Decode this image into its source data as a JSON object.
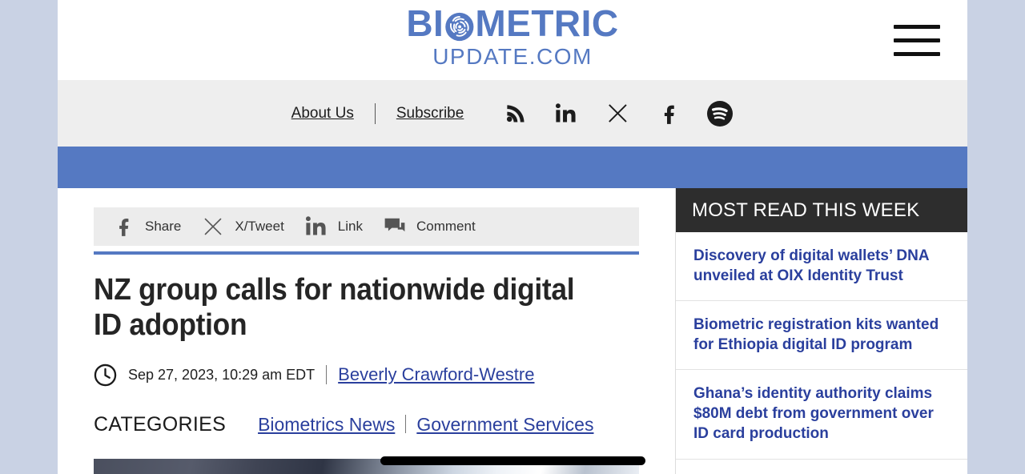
{
  "site": {
    "logo_left": "BI",
    "logo_icon": "fingerprint-icon",
    "logo_right": "METRIC",
    "logo_sub": "UPDATE.COM",
    "menu_icon": "hamburger-icon",
    "brand_color": "#5579c2"
  },
  "utility_nav": {
    "links": [
      {
        "label": "About Us"
      },
      {
        "label": "Subscribe"
      }
    ],
    "social": [
      {
        "name": "rss-icon"
      },
      {
        "name": "linkedin-icon"
      },
      {
        "name": "x-twitter-icon"
      },
      {
        "name": "facebook-icon"
      },
      {
        "name": "spotify-icon"
      }
    ]
  },
  "share_bar": {
    "items": [
      {
        "icon": "facebook-icon",
        "label": "Share"
      },
      {
        "icon": "x-twitter-icon",
        "label": "X/Tweet"
      },
      {
        "icon": "linkedin-icon",
        "label": "Link"
      },
      {
        "icon": "comment-icon",
        "label": "Comment"
      }
    ]
  },
  "article": {
    "headline": "NZ group calls for nationwide digital ID adoption",
    "clock_icon": "clock-icon",
    "date": "Sep 27, 2023, 10:29 am EDT",
    "author": "Beverly Crawford-Westre",
    "categories_label": "CATEGORIES",
    "categories": [
      {
        "label": "Biometrics News"
      },
      {
        "label": "Government Services"
      }
    ]
  },
  "sidebar": {
    "title": "MOST READ THIS WEEK",
    "items": [
      {
        "title": "Discovery of digital wallets’ DNA unveiled at OIX Identity Trust"
      },
      {
        "title": "Biometric registration kits wanted for Ethiopia digital ID program"
      },
      {
        "title": "Ghana’s identity authority claims $80M debt from government over ID card production"
      }
    ]
  },
  "colors": {
    "page_background": "#c9d2e4",
    "brand_blue": "#5579c2",
    "link_blue": "#2a3f9d",
    "sidebar_header_bg": "#2d2d2d",
    "utility_bar_bg": "#eeeeee"
  }
}
